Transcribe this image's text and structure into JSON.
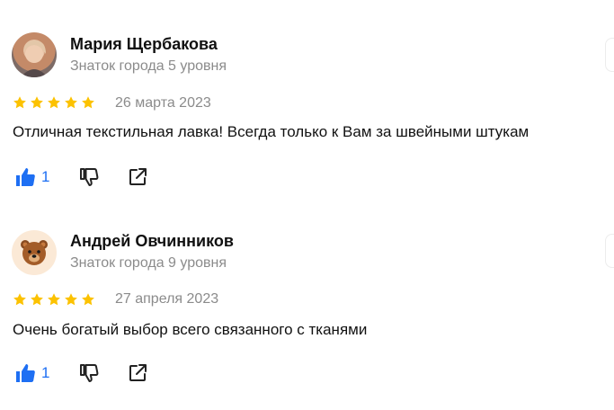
{
  "reviews": [
    {
      "author": "Мария Щербакова",
      "level": "Знаток города 5 уровня",
      "date": "26 марта 2023",
      "rating": 5,
      "text": "Отличная текстильная лавка! Всегда только к Вам за швейными штукам",
      "likes": "1",
      "avatar": "user-photo"
    },
    {
      "author": "Андрей Овчинников",
      "level": "Знаток города 9 уровня",
      "date": "27 апреля 2023",
      "rating": 5,
      "text": "Очень богатый выбор всего связанного с тканями",
      "likes": "1",
      "avatar": "bear-avatar"
    }
  ],
  "colors": {
    "star": "#fcc200",
    "like": "#1e6ff3",
    "muted": "#8b8b8b"
  },
  "icons": [
    "thumb-up-icon",
    "thumb-down-icon",
    "share-icon",
    "star-icon"
  ]
}
